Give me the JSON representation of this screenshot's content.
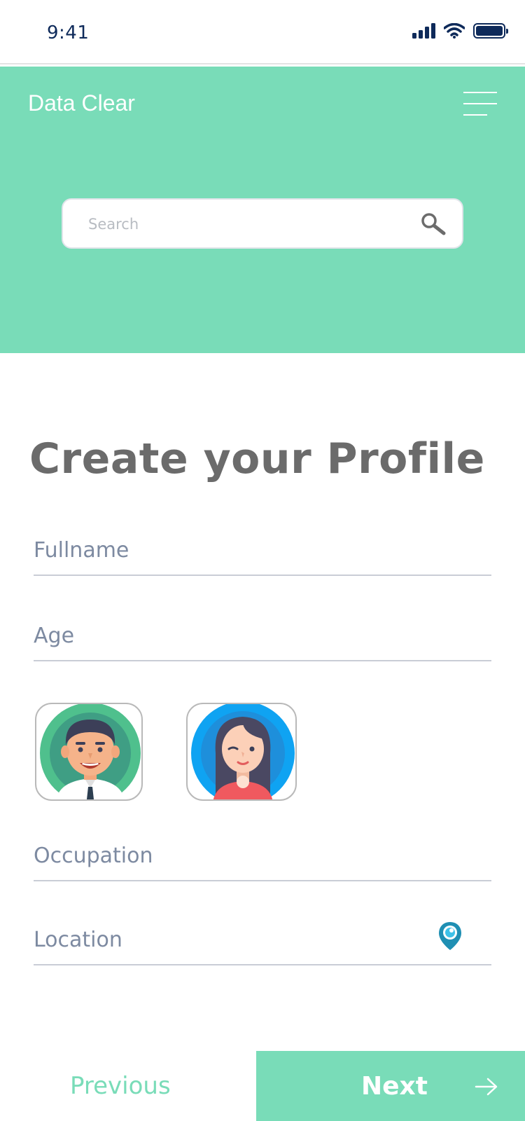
{
  "status_bar": {
    "time": "9:41",
    "icons": [
      "signal-bars-icon",
      "wifi-icon",
      "battery-icon"
    ],
    "battery_level_percent": 100
  },
  "header": {
    "app_title": "Data Clear",
    "menu_icon": "hamburger-menu-icon",
    "search": {
      "placeholder": "Search",
      "value": "",
      "icon": "search-icon"
    },
    "background_color": "#79dcb8"
  },
  "main": {
    "page_title": "Create your Profile",
    "fields": {
      "fullname": {
        "placeholder": "Fullname",
        "value": ""
      },
      "age": {
        "placeholder": "Age",
        "value": ""
      },
      "occupation": {
        "placeholder": "Occupation",
        "value": ""
      },
      "location": {
        "placeholder": "Location",
        "value": "",
        "icon": "location-pin-icon"
      }
    },
    "avatars": [
      {
        "name": "male-avatar",
        "icon": "male-avatar-icon"
      },
      {
        "name": "female-avatar",
        "icon": "female-avatar-icon"
      }
    ]
  },
  "footer": {
    "previous_label": "Previous",
    "next_label": "Next",
    "next_icon": "arrow-right-icon",
    "accent_color": "#79dcb8"
  }
}
